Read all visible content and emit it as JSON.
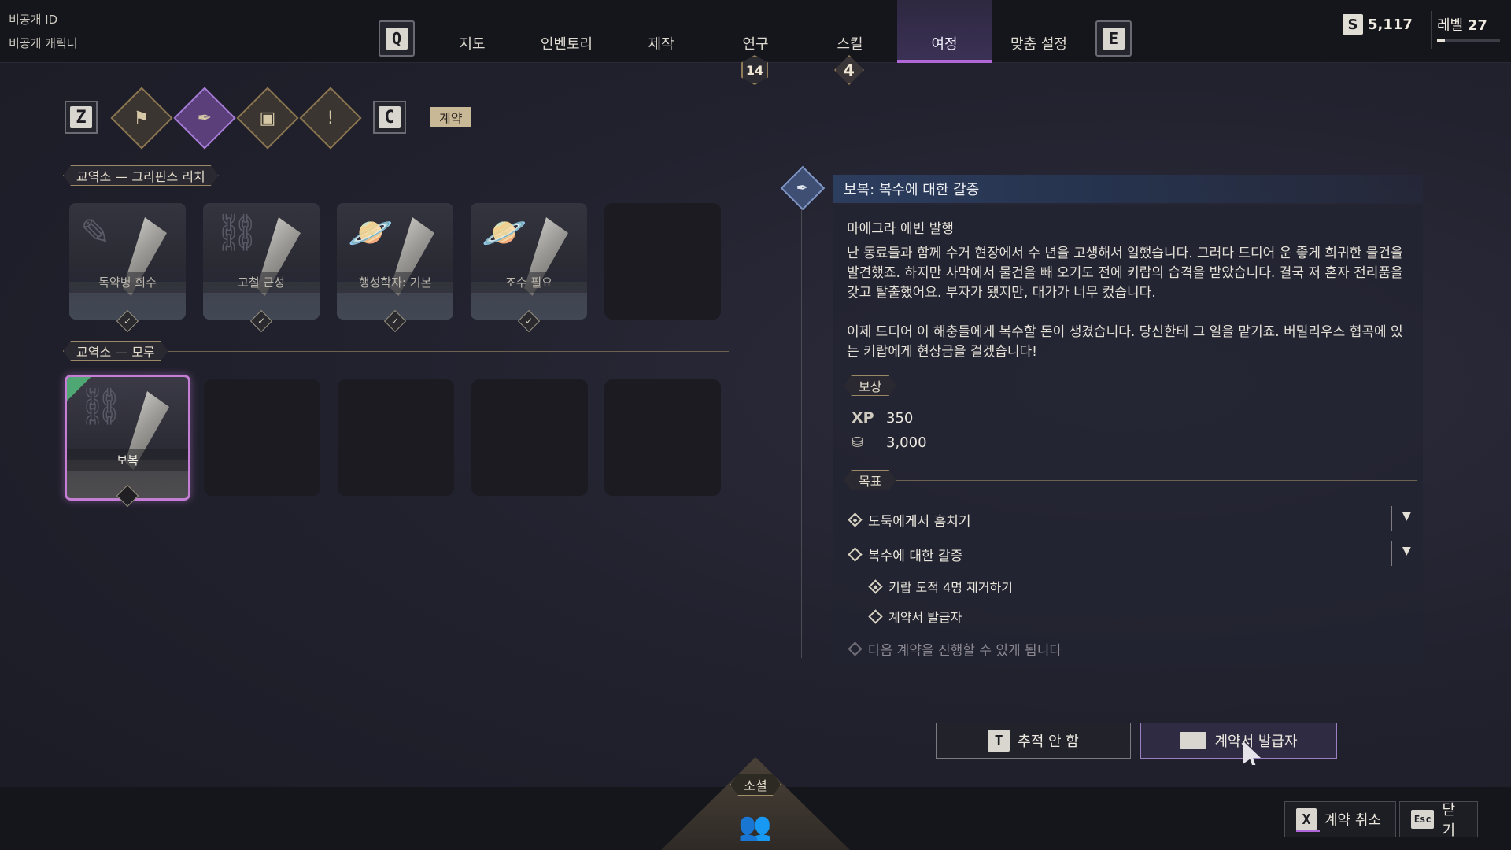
{
  "player": {
    "id": "비공개 ID",
    "character": "비공개 캐릭터"
  },
  "topnav": {
    "left_key": "Q",
    "right_key": "E",
    "tabs": [
      {
        "label": "지도"
      },
      {
        "label": "인벤토리"
      },
      {
        "label": "제작"
      },
      {
        "label": "연구",
        "badge": "14"
      },
      {
        "label": "스킬",
        "badge": "4"
      },
      {
        "label": "여정",
        "active": true
      },
      {
        "label": "맞춤 설정"
      }
    ]
  },
  "currency": {
    "icon": "S",
    "amount": "5,117"
  },
  "level": {
    "label": "레벨",
    "value": "27",
    "progress": 0.12
  },
  "filters": {
    "left_key": "Z",
    "right_key": "C",
    "icons": [
      "bookmark-icon",
      "pen-nib-icon",
      "card-icon",
      "exclamation-icon"
    ],
    "active_label": "계약"
  },
  "sections": [
    {
      "title": "교역소 — 그리핀스 리치",
      "cards": [
        {
          "name": "독약병 회수",
          "icon": "document-pen-icon"
        },
        {
          "name": "고철 근성",
          "icon": "chain-link-icon"
        },
        {
          "name": "행성학자: 기본",
          "icon": "planet-icon"
        },
        {
          "name": "조수 필요",
          "icon": "planet-icon"
        }
      ]
    },
    {
      "title": "교역소 — 모루",
      "cards": [
        {
          "name": "보복",
          "icon": "chain-link-icon",
          "selected": true
        }
      ]
    }
  ],
  "detail": {
    "title": "보복: 복수에 대한 갈증",
    "issuer": "마에그라 에빈 발행",
    "paragraphs": [
      "난 동료들과 함께 수거 현장에서 수 년을 고생해서 일했습니다. 그러다 드디어 운 좋게 희귀한 물건을 발견했죠. 하지만 사막에서 물건을 빼 오기도 전에 키랍의 습격을 받았습니다. 결국 저 혼자 전리품을 갖고 탈출했어요. 부자가 됐지만, 대가가 너무 컸습니다.",
      "이제 드디어 이 해충들에게 복수할 돈이 생겼습니다. 당신한테 그 일을 맡기죠. 버밀리우스 협곡에 있는 키랍에게 현상금을 걸겠습니다!"
    ],
    "rewards_label": "보상",
    "rewards": {
      "xp_label": "XP",
      "xp": "350",
      "credits": "3,000"
    },
    "objectives_label": "목표",
    "objectives": [
      {
        "text": "도둑에게서 훔치기",
        "done": true,
        "level": 0,
        "expandable": true
      },
      {
        "text": "복수에 대한 갈증",
        "done": false,
        "level": 0,
        "expandable": true
      },
      {
        "text": "키랍 도적 4명 제거하기",
        "done": true,
        "level": 1
      },
      {
        "text": "계약서 발급자",
        "done": false,
        "level": 1
      },
      {
        "text": "다음 계약을 진행할 수 있게 됩니다",
        "done": false,
        "level": 0,
        "dim": true
      }
    ]
  },
  "actions": {
    "track": {
      "key": "T",
      "label": "추적 안 함"
    },
    "issuer": {
      "key": "—",
      "label": "계약서 발급자"
    }
  },
  "social": {
    "label": "소셜"
  },
  "footer": {
    "cancel": {
      "key": "X",
      "label": "계약 취소"
    },
    "close": {
      "key": "Esc",
      "label": "닫기"
    }
  }
}
